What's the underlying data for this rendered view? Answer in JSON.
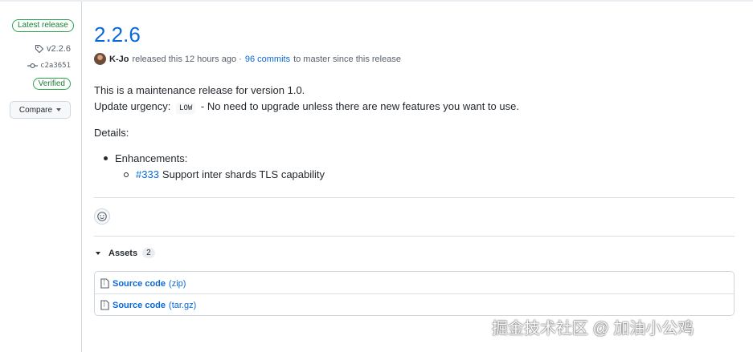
{
  "sidebar": {
    "badge": "Latest release",
    "tag": "v2.2.6",
    "commit": "c2a3651",
    "verified": "Verified",
    "compare": "Compare"
  },
  "release": {
    "title": "2.2.6",
    "author": "K-Jo",
    "released_text": "released this 12 hours ago ·",
    "commits_link": "96 commits",
    "commits_suffix": "to master since this release"
  },
  "body": {
    "line1": "This is a maintenance release for version 1.0.",
    "urgency_prefix": "Update urgency:",
    "urgency_value": "LOW",
    "urgency_suffix": "- No need to upgrade unless there are new features you want to use.",
    "details": "Details:",
    "bullet1": "Enhancements:",
    "sub_link": "#333",
    "sub_text": "Support inter shards TLS capability"
  },
  "assets": {
    "label": "Assets",
    "count": "2",
    "items": [
      {
        "name": "Source code",
        "ext": "(zip)"
      },
      {
        "name": "Source code",
        "ext": "(tar.gz)"
      }
    ]
  },
  "watermark": "掘金技术社区 @ 加油小公鸡",
  "colors": {
    "link": "#0969da",
    "verified": "#1a7f37",
    "border": "#d0d7de"
  },
  "icons": [
    "tag-icon",
    "commit-icon",
    "smiley-icon",
    "file-zip-icon"
  ]
}
